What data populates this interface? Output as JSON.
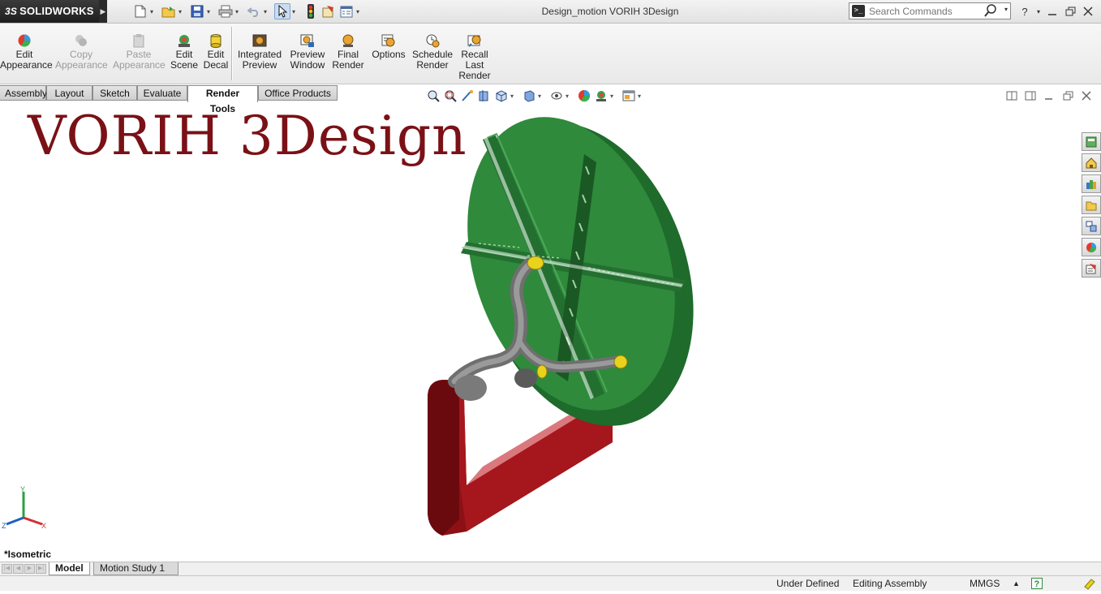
{
  "app": {
    "brand": "SOLIDWORKS",
    "brand_prefix": "3S",
    "window_title": "Design_motion VORIH 3Design"
  },
  "search": {
    "placeholder": "Search Commands",
    "value": ""
  },
  "ribbon": {
    "buttons": [
      {
        "label": "Edit\nAppearance",
        "icon": "edit-appearance-icon",
        "enabled": true
      },
      {
        "label": "Copy\nAppearance",
        "icon": "copy-appearance-icon",
        "enabled": false
      },
      {
        "label": "Paste\nAppearance",
        "icon": "paste-appearance-icon",
        "enabled": false
      },
      {
        "label": "Edit\nScene",
        "icon": "edit-scene-icon",
        "enabled": true
      },
      {
        "label": "Edit\nDecal",
        "icon": "edit-decal-icon",
        "enabled": true
      },
      {
        "label": "Integrated\nPreview",
        "icon": "integrated-preview-icon",
        "enabled": true
      },
      {
        "label": "Preview\nWindow",
        "icon": "preview-window-icon",
        "enabled": true
      },
      {
        "label": "Final\nRender",
        "icon": "final-render-icon",
        "enabled": true
      },
      {
        "label": "Options",
        "icon": "render-options-icon",
        "enabled": true
      },
      {
        "label": "Schedule\nRender",
        "icon": "schedule-render-icon",
        "enabled": true
      },
      {
        "label": "Recall\nLast\nRender",
        "icon": "recall-last-render-icon",
        "enabled": true
      }
    ]
  },
  "tabs": [
    {
      "label": "Assembly",
      "active": false
    },
    {
      "label": "Layout",
      "active": false
    },
    {
      "label": "Sketch",
      "active": false
    },
    {
      "label": "Evaluate",
      "active": false
    },
    {
      "label": "Render Tools",
      "active": true
    },
    {
      "label": "Office Products",
      "active": false
    }
  ],
  "graphics": {
    "watermark": "VORIH 3Design",
    "view_name": "*Isometric",
    "triad_labels": {
      "x": "X",
      "y": "Y",
      "z": "Z"
    }
  },
  "bottom_tabs": [
    {
      "label": "Model",
      "active": true
    },
    {
      "label": "Motion Study 1",
      "active": false
    }
  ],
  "status": {
    "definition": "Under Defined",
    "mode": "Editing Assembly",
    "units": "MMGS"
  },
  "colors": {
    "wheel": "#2f8a3c",
    "handle": "#a01418",
    "tube": "#808080",
    "fitting": "#e8d21c",
    "watermark": "#7a1116"
  }
}
